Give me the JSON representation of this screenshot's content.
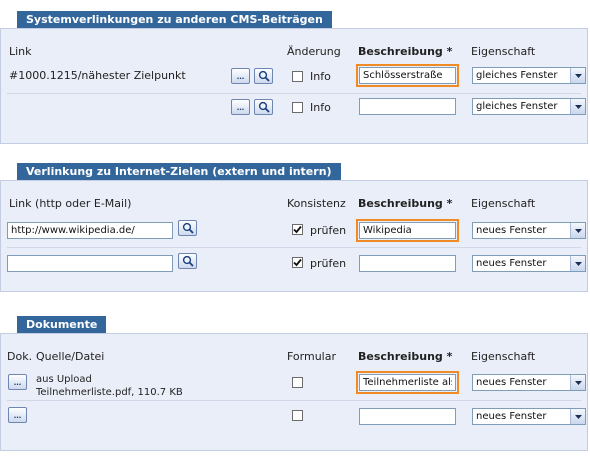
{
  "sections": {
    "system": {
      "title": "Systemverlinkungen zu anderen CMS-Beiträgen",
      "headers": {
        "link": "Link",
        "change": "Änderung",
        "desc": "Beschreibung *",
        "prop": "Eigenschaft"
      },
      "rows": [
        {
          "link_text": "#1000.1215/nähester Zielpunkt",
          "info_label": "Info",
          "info_checked": false,
          "description": "Schlösserstraße",
          "property": "gleiches Fenster"
        },
        {
          "link_text": "",
          "info_label": "Info",
          "info_checked": false,
          "description": "",
          "property": "gleiches Fenster"
        }
      ]
    },
    "internet": {
      "title": "Verlinkung zu Internet-Zielen (extern und intern)",
      "headers": {
        "link": "Link (http oder E-Mail)",
        "consistency": "Konsistenz",
        "desc": "Beschreibung *",
        "prop": "Eigenschaft"
      },
      "rows": [
        {
          "url": "http://www.wikipedia.de/",
          "check_label": "prüfen",
          "check_checked": true,
          "description": "Wikipedia",
          "property": "neues Fenster"
        },
        {
          "url": "",
          "check_label": "prüfen",
          "check_checked": true,
          "description": "",
          "property": "neues Fenster"
        }
      ]
    },
    "docs": {
      "title": "Dokumente",
      "headers": {
        "dok": "Dok.",
        "source": "Quelle/Datei",
        "form": "Formular",
        "desc": "Beschreibung *",
        "prop": "Eigenschaft"
      },
      "rows": [
        {
          "source_line1": "aus Upload",
          "source_line2": "Teilnehmerliste.pdf, 110.7 KB",
          "form_checked": false,
          "description": "Teilnehmerliste als pdf",
          "property": "neues Fenster"
        },
        {
          "source_line1": "",
          "source_line2": "",
          "form_checked": false,
          "description": "",
          "property": "neues Fenster"
        }
      ]
    }
  },
  "icons": {
    "browse": "ellipsis-icon",
    "search": "magnifier-icon",
    "dropdown": "chevron-down-icon"
  },
  "colors": {
    "tab": "#33669b",
    "panel": "#eaeef8",
    "highlight": "#f08a24"
  }
}
